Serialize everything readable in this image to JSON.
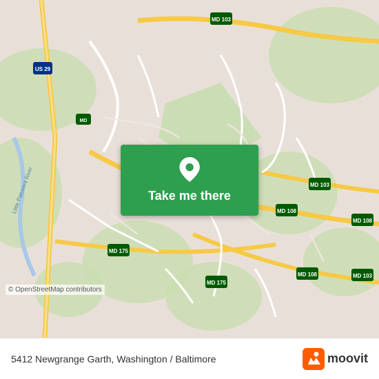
{
  "map": {
    "background_color": "#e8e0d8",
    "osm_credit": "© OpenStreetMap contributors"
  },
  "button": {
    "label": "Take me there",
    "background_color": "#2e9e4f",
    "pin_icon": "location-pin"
  },
  "info_bar": {
    "address": "5412 Newgrange Garth, Washington / Baltimore",
    "logo_text": "moovit",
    "logo_icon": "moovit-logo"
  }
}
